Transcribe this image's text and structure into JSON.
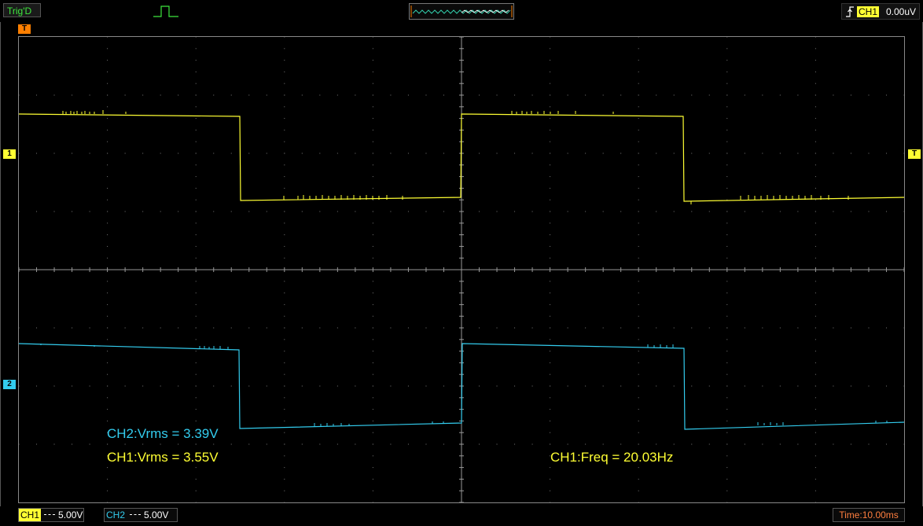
{
  "header": {
    "trigger_status": "Trig'D",
    "trigger_channel": "CH1",
    "trigger_level": "0.00uV"
  },
  "markers": {
    "trigger_position": "T",
    "ch1": "1",
    "ch2": "2",
    "trigger_level_marker": "T"
  },
  "measurements": {
    "ch2_vrms": "CH2:Vrms = 3.39V",
    "ch1_vrms": "CH1:Vrms = 3.55V",
    "ch1_freq": "CH1:Freq = 20.03Hz"
  },
  "footer": {
    "ch1_label": "CH1",
    "ch1_scale": "5.00V",
    "ch2_label": "CH2",
    "ch2_scale": "5.00V",
    "timebase": "Time:10.00ms"
  },
  "colors": {
    "ch1": "#ffff33",
    "ch2": "#33ccee",
    "trigger": "#ff7f00",
    "grid": "#777777",
    "status_green": "#3ee73e"
  },
  "icons": {
    "trigger_wave": "pulse-icon",
    "edge": "rising-edge-icon"
  }
}
